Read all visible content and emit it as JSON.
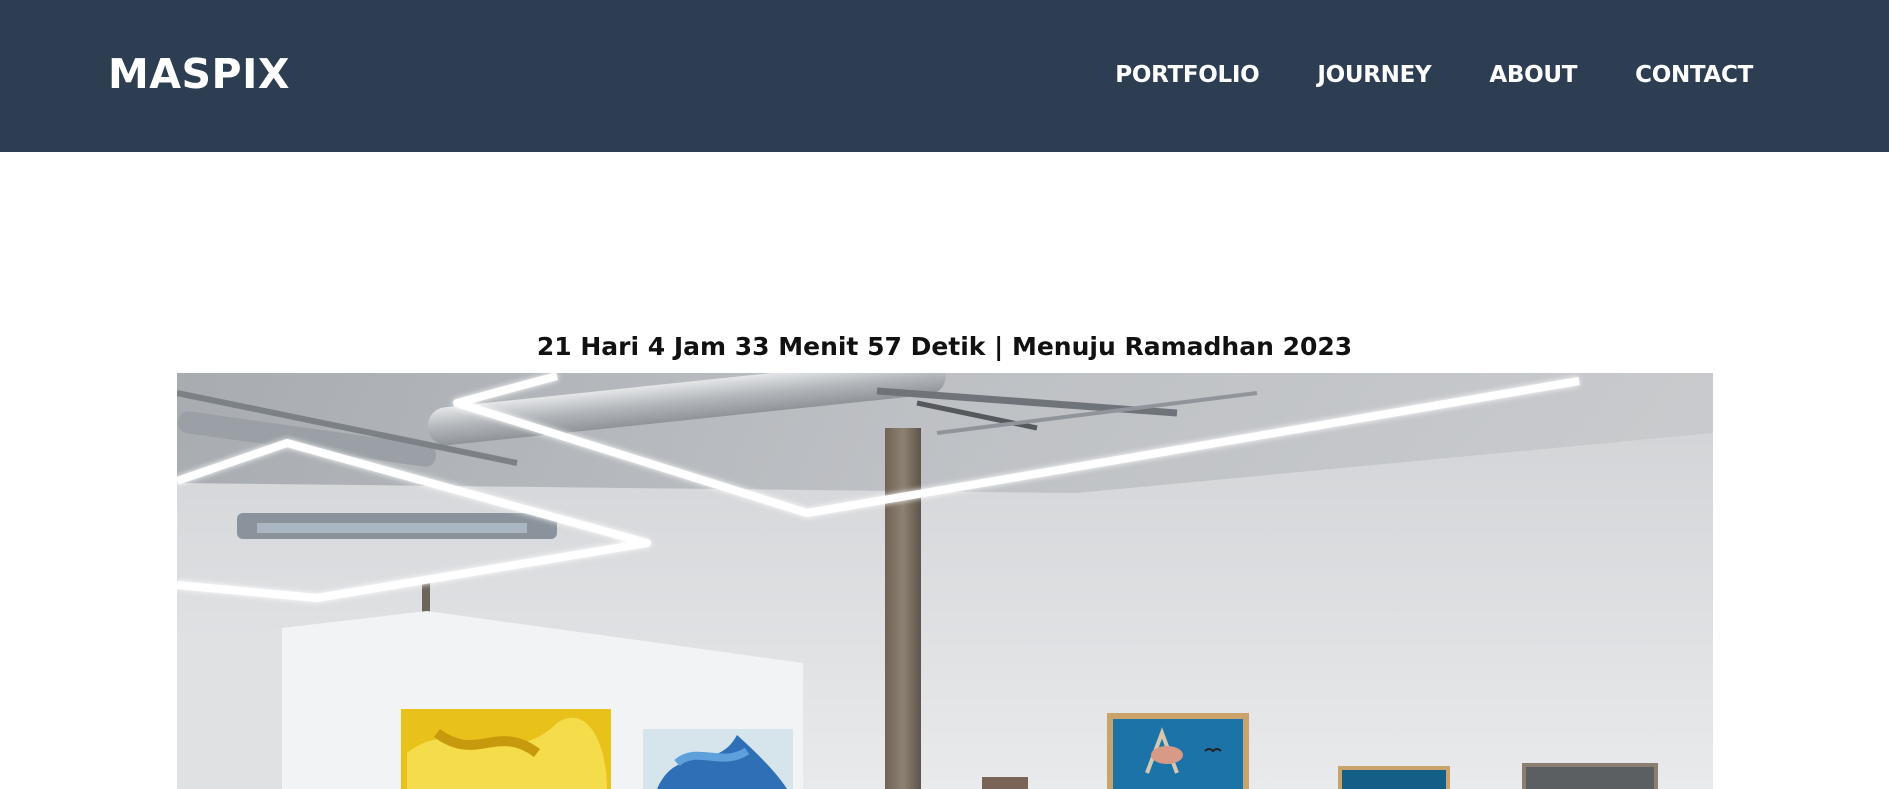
{
  "brand": {
    "name": "MASPIX"
  },
  "nav": {
    "items": [
      {
        "label": "PORTFOLIO"
      },
      {
        "label": "JOURNEY"
      },
      {
        "label": "ABOUT"
      },
      {
        "label": "CONTACT"
      }
    ]
  },
  "countdown": {
    "text": "21 Hari 4 Jam 33 Menit 57 Detik | Menuju Ramadhan 2023"
  },
  "hero": {
    "alt": "art-gallery-photo"
  },
  "colors": {
    "navbar_bg": "#2e3e52",
    "nav_text": "#ffffff"
  }
}
